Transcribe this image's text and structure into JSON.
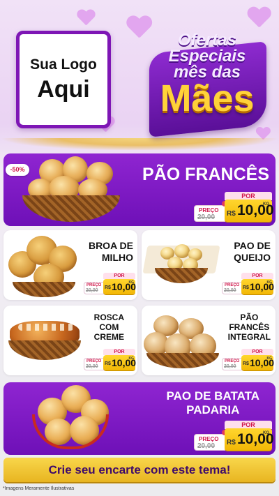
{
  "header": {
    "logo_line1": "Sua Logo",
    "logo_line2": "Aqui",
    "promo_line1": "Ofertas",
    "promo_line2": "Especiais",
    "promo_line3": "mês das",
    "promo_line4": "Mães"
  },
  "badge": {
    "discount": "-50%"
  },
  "products": [
    {
      "name": "PÃO FRANCÊS",
      "preco_label": "PREÇO",
      "por_label": "POR",
      "old_price": "20,00",
      "currency": "R$",
      "price": "10,00",
      "unit": "KG"
    },
    {
      "name_line1": "BROA DE",
      "name_line2": "MILHO",
      "preco_label": "PREÇO",
      "por_label": "POR",
      "old_price": "20,00",
      "currency": "R$",
      "price": "10,00",
      "unit": "KG"
    },
    {
      "name_line1": "PAO DE",
      "name_line2": "QUEIJO",
      "preco_label": "PREÇO",
      "por_label": "POR",
      "old_price": "20,00",
      "currency": "R$",
      "price": "10,00",
      "unit": "KG"
    },
    {
      "name_line1": "ROSCA",
      "name_line2": "COM",
      "name_line3": "CREME",
      "preco_label": "PREÇO",
      "por_label": "POR",
      "old_price": "20,00",
      "currency": "R$",
      "price": "10,00",
      "unit": "KG"
    },
    {
      "name_line1": "PÃO",
      "name_line2": "FRANCÊS",
      "name_line3": "INTEGRAL",
      "preco_label": "PREÇO",
      "por_label": "POR",
      "old_price": "20,00",
      "currency": "R$",
      "price": "10,00",
      "unit": "KG"
    },
    {
      "name_line1": "PAO DE BATATA",
      "name_line2": "PADARIA",
      "preco_label": "PREÇO",
      "por_label": "POR",
      "old_price": "20,00",
      "currency": "R$",
      "price": "10,00",
      "unit": "KG"
    }
  ],
  "cta": {
    "label": "Crie seu encarte com este tema!"
  },
  "footnote": "*Imagens Meramente Ilustrativas",
  "colors": {
    "purple": "#7e16b5",
    "gold": "#f2b705",
    "red": "#d0164a"
  }
}
